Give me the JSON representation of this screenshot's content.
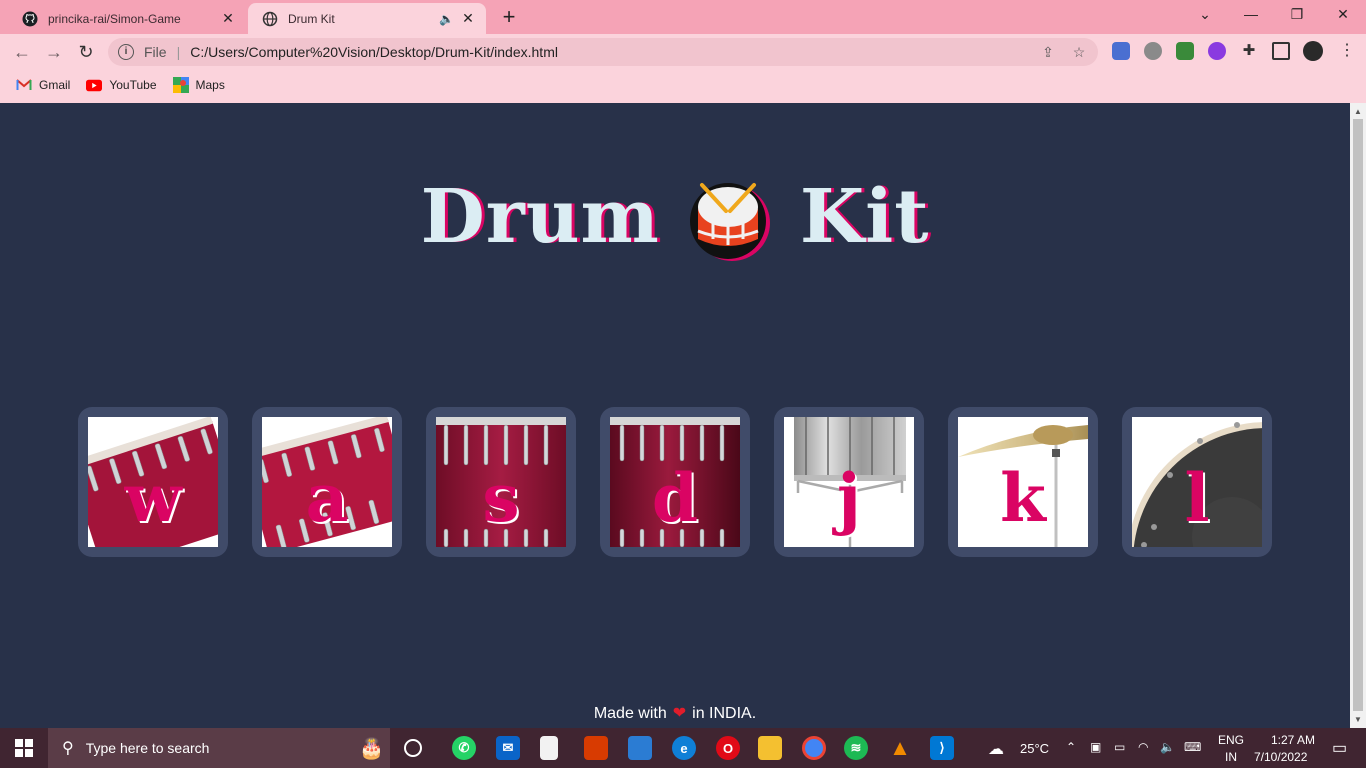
{
  "browser": {
    "tabs": [
      {
        "title": "princika-rai/Simon-Game",
        "favicon": "github-icon"
      },
      {
        "title": "Drum Kit",
        "favicon": "globe-icon",
        "audio": "speaker-icon"
      }
    ],
    "address": {
      "scheme_label": "File",
      "url": "C:/Users/Computer%20Vision/Desktop/Drum-Kit/index.html"
    },
    "bookmarks": [
      {
        "label": "Gmail",
        "icon": "gmail-icon"
      },
      {
        "label": "YouTube",
        "icon": "youtube-icon"
      },
      {
        "label": "Maps",
        "icon": "maps-icon"
      }
    ]
  },
  "page": {
    "title_left": "Drum",
    "title_right": "Kit",
    "drums": [
      {
        "key": "w",
        "image": "tom-tom-1"
      },
      {
        "key": "a",
        "image": "tom-tom-2"
      },
      {
        "key": "s",
        "image": "tom-tom-3"
      },
      {
        "key": "d",
        "image": "tom-tom-4"
      },
      {
        "key": "j",
        "image": "snare"
      },
      {
        "key": "k",
        "image": "crash-cymbal"
      },
      {
        "key": "l",
        "image": "kick-bass"
      }
    ],
    "footer": {
      "prefix": "Made with",
      "suffix": "in INDIA."
    }
  },
  "taskbar": {
    "search_placeholder": "Type here to search",
    "weather": "25°C",
    "language": "ENG",
    "region": "IN",
    "time": "1:27 AM",
    "date": "7/10/2022"
  },
  "colors": {
    "page_bg": "#283149",
    "tile_bg": "#404b69",
    "accent": "#da0463",
    "title_text": "#dbedf3",
    "chrome_bg": "#fbd3dc",
    "tabstrip_bg": "#f5a3b6"
  }
}
